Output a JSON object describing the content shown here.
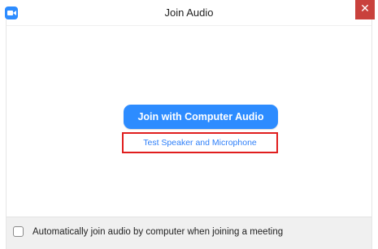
{
  "window": {
    "title": "Join Audio",
    "close_symbol": "✕"
  },
  "main": {
    "join_button_label": "Join with Computer Audio",
    "test_link_label": "Test Speaker and Microphone"
  },
  "footer": {
    "checkbox_checked": false,
    "auto_join_label": "Automatically join audio by computer when joining a meeting"
  },
  "icons": {
    "app": "zoom-camera-icon",
    "close": "close-icon"
  },
  "colors": {
    "accent": "#2d8cff",
    "link": "#2d7ff9",
    "highlight_frame": "#e01e1e",
    "close_button": "#c9413c",
    "footer_bg": "#f0f0f0"
  }
}
